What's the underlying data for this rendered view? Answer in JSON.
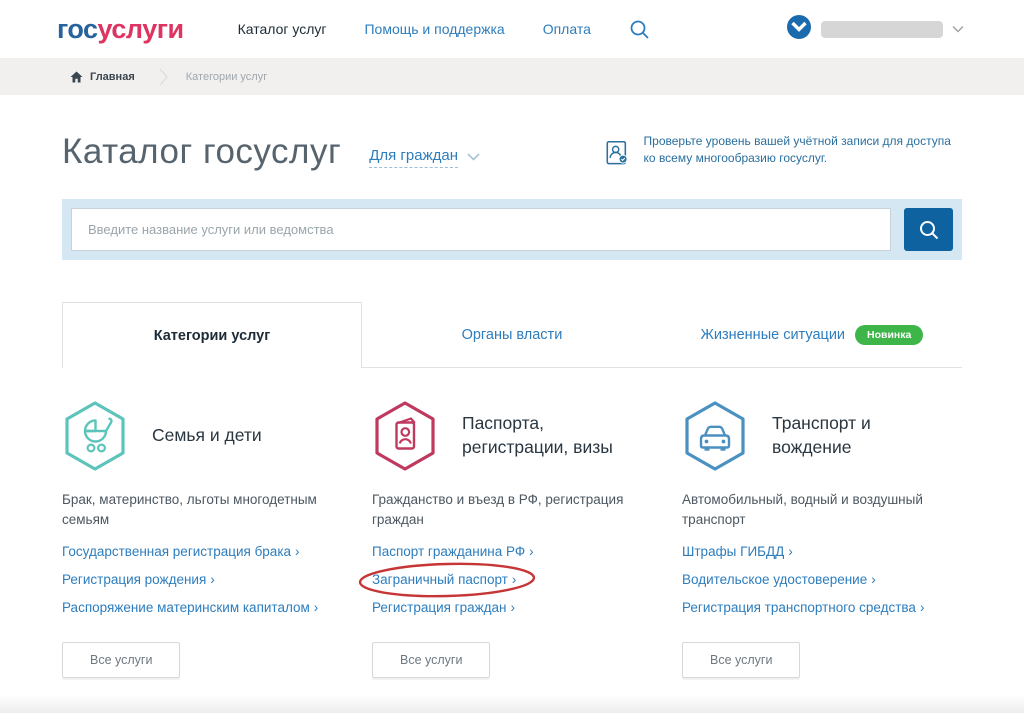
{
  "colors": {
    "brand_blue": "#28639c",
    "brand_red": "#dd3461",
    "link_blue": "#2d7dbd",
    "search_band_blue": "#d5e7f2",
    "search_button_blue": "#0d629f",
    "badge_green": "#3eb549",
    "annotation_red": "#c63636",
    "icon_teal": "#5cc4bb",
    "icon_crimson": "#bf3a5e",
    "icon_blue": "#4a90c0"
  },
  "ui": {
    "link_arrow": "›"
  },
  "header": {
    "logo_blue": "гос",
    "logo_red": "услуги",
    "nav": [
      {
        "label": "Каталог услуг"
      },
      {
        "label": "Помощь и поддержка"
      },
      {
        "label": "Оплата"
      }
    ]
  },
  "breadcrumb": {
    "home": "Главная",
    "current": "Категории услуг"
  },
  "hero": {
    "title": "Каталог госуслуг",
    "audience_selector": "Для граждан",
    "account_notice": "Проверьте уровень вашей учётной записи для доступа ко всему многообразию госуслуг."
  },
  "search": {
    "placeholder": "Введите название услуги или ведомства"
  },
  "tabs": [
    {
      "label": "Категории услуг",
      "active": true
    },
    {
      "label": "Органы власти",
      "active": false
    },
    {
      "label": "Жизненные ситуации",
      "active": false,
      "badge": "Новинка"
    }
  ],
  "categories": [
    {
      "icon": "stroller-icon",
      "title": "Семья и дети",
      "description": "Брак, материнство, льготы многодетным семьям",
      "links": [
        "Государственная регистрация брака",
        "Регистрация рождения",
        "Распоряжение материнским капиталом"
      ],
      "all_services_label": "Все услуги"
    },
    {
      "icon": "passport-icon",
      "title": "Паспорта, регистрации, визы",
      "description": "Гражданство и въезд в РФ, регистрация граждан",
      "links": [
        "Паспорт гражданина РФ",
        "Заграничный паспорт",
        "Регистрация граждан"
      ],
      "highlighted_link": "Заграничный паспорт",
      "all_services_label": "Все услуги"
    },
    {
      "icon": "car-icon",
      "title": "Транспорт и вождение",
      "description": "Автомобильный, водный и воздушный транспорт",
      "links": [
        "Штрафы ГИБДД",
        "Водительское удостоверение",
        "Регистрация транспортного средства"
      ],
      "all_services_label": "Все услуги"
    }
  ]
}
